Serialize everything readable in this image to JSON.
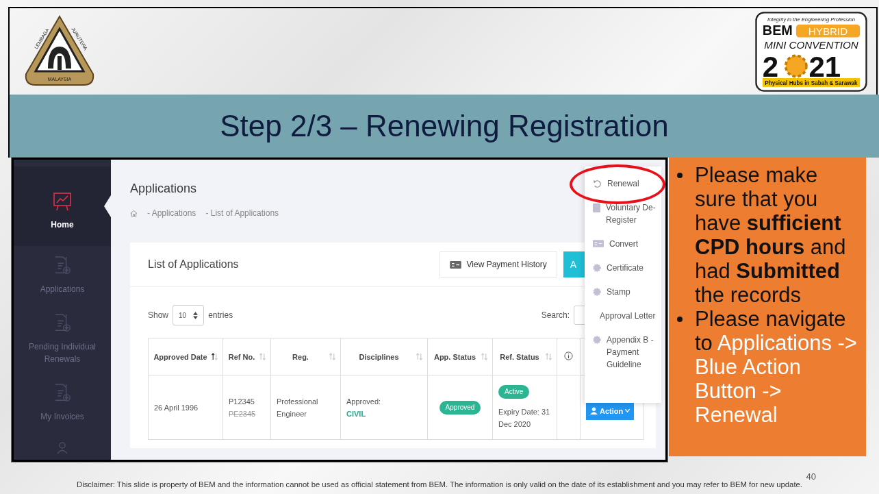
{
  "logos": {
    "left": {
      "top_left": "LEMBAGA",
      "top_right": "JURUTERA",
      "bottom": "MALAYSIA"
    },
    "right": {
      "tagline": "Integrity in the Engineering Profession",
      "brand": "BEM",
      "badge": "HYBRID",
      "subtitle": "MINI CONVENTION",
      "year_start": "2",
      "year_end": "21",
      "hubs": "Physical Hubs in Sabah & Sarawak"
    }
  },
  "title": "Step 2/3 – Renewing Registration",
  "screenshot": {
    "sidebar": [
      {
        "label": "Home",
        "kind": "chart",
        "selected": true
      },
      {
        "label": "Applications",
        "kind": "document",
        "selected": false
      },
      {
        "label": "Pending Individual Renewals",
        "kind": "document",
        "selected": false
      },
      {
        "label": "My Invoices",
        "kind": "document",
        "selected": false
      },
      {
        "kind": "person",
        "selected": false
      }
    ],
    "page_title": "Applications",
    "breadcrumb": [
      "- Applications",
      "- List of Applications"
    ],
    "card": {
      "title": "List of Applications",
      "history_button": "View Payment History",
      "add_button": "A",
      "show_label": "Show",
      "page_size": "10",
      "entries_label": "entries",
      "search_label": "Search:"
    },
    "table": {
      "columns": [
        {
          "kind": "text",
          "label": "Approved Date",
          "sorted": true
        },
        {
          "kind": "text",
          "label": "Ref No.",
          "sorted": false
        },
        {
          "kind": "text",
          "label": "Reg.",
          "sorted": false
        },
        {
          "kind": "text",
          "label": "Disciplines",
          "sorted": false
        },
        {
          "kind": "text",
          "label": "App. Status",
          "sorted": false
        },
        {
          "kind": "text",
          "label": "Ref. Status",
          "sorted": false
        },
        {
          "kind": "info"
        },
        {
          "kind": "empty"
        }
      ],
      "rows": [
        {
          "approved_date": "26 April 1996",
          "ref_no": "P12345",
          "old_ref_no": "PE2345",
          "reg": "Professional Engineer",
          "discipline_label": "Approved:",
          "discipline": "CIVIL",
          "app_status": "Approved",
          "ref_status": "Active",
          "expiry": "Expiry Date: 31 Dec 2020",
          "action": "Action"
        }
      ]
    },
    "action_menu": [
      {
        "label": "Renewal",
        "kind": "undo",
        "selected": true
      },
      {
        "label": "Voluntary De-Register",
        "kind": "document",
        "selected": false
      },
      {
        "label": "Convert",
        "kind": "card",
        "selected": false
      },
      {
        "label": "Certificate",
        "kind": "seal",
        "selected": false
      },
      {
        "label": "Stamp",
        "kind": "seal",
        "selected": false
      },
      {
        "label": "Approval Letter",
        "kind": "plain",
        "selected": false
      },
      {
        "label": "Appendix B - Payment Guideline",
        "kind": "seal",
        "selected": false
      }
    ]
  },
  "notes": [
    {
      "parts": [
        {
          "text": "Please make sure that you have **sufficient CPD hours** and had **Submitted** the records",
          "color": "#111111"
        }
      ]
    },
    {
      "parts": [
        {
          "text": "Please navigate to ",
          "color": "#111111"
        },
        {
          "text": "Applications -> Blue Action Button -> Renewal",
          "color": "#ffffff"
        }
      ]
    }
  ],
  "page_number": "40",
  "disclaimer": "Disclaimer: This slide is property of BEM and the information cannot be used as official statement from BEM. The information is only valid on the date of its establishment and you may refer to BEM for new update."
}
